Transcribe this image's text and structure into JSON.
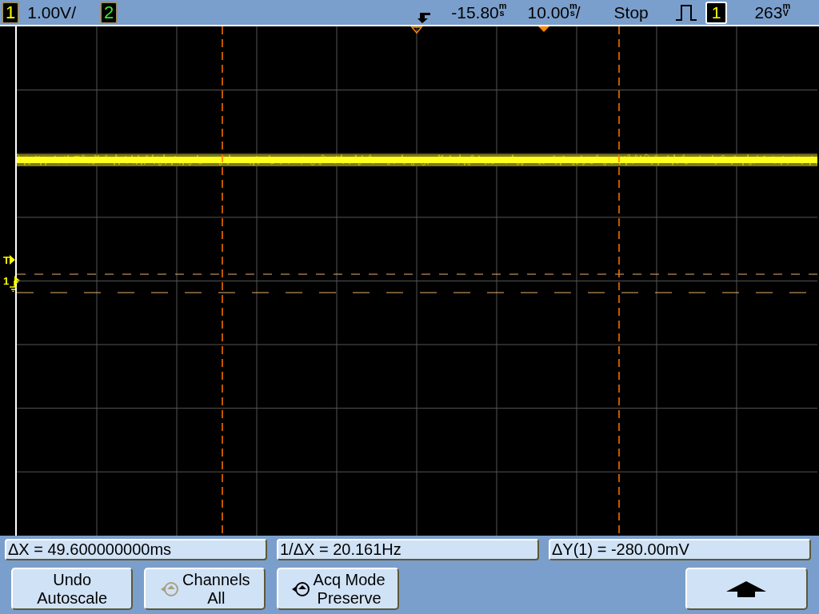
{
  "top_bar": {
    "channels": [
      {
        "label": "1",
        "scale": "1.00V/"
      },
      {
        "label": "2"
      }
    ],
    "delay": {
      "value": "-15.80",
      "unit": "ms"
    },
    "timebase": {
      "value": "10.00",
      "unit": "ms",
      "suffix": "/"
    },
    "run_state": "Stop",
    "trigger": {
      "channel": "1",
      "level": "263",
      "unit": "mV"
    }
  },
  "left_markers": [
    {
      "label": "T"
    },
    {
      "label": "1"
    }
  ],
  "measurements": [
    "ΔX = 49.600000000ms",
    "1/ΔX = 20.161Hz",
    "ΔY(1) = -280.00mV"
  ],
  "softkeys": [
    {
      "kind": "text",
      "lines": [
        "Undo",
        "Autoscale"
      ]
    },
    {
      "kind": "knob",
      "lines": [
        "Channels",
        "All"
      ],
      "disabled": true
    },
    {
      "kind": "knob",
      "lines": [
        "Acq Mode",
        "Preserve"
      ],
      "disabled": false
    },
    {
      "kind": "blank"
    },
    {
      "kind": "up"
    }
  ]
}
